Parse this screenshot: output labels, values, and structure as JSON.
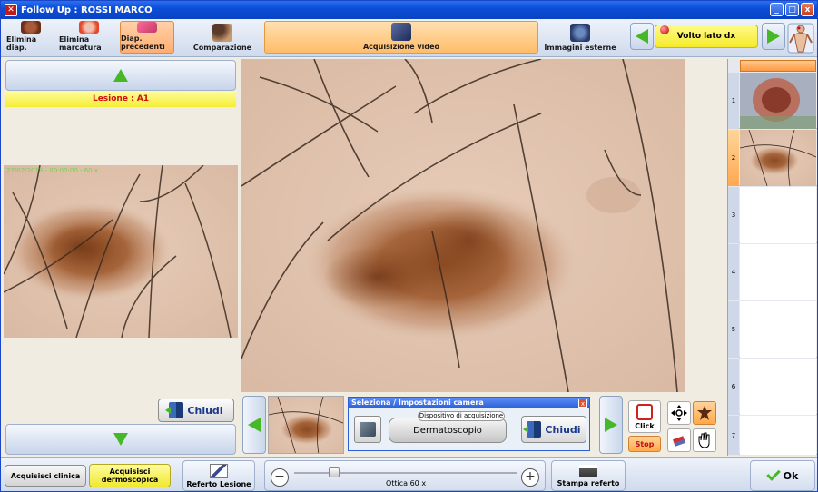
{
  "window": {
    "title": "Follow Up : ROSSI MARCO",
    "controls": {
      "minimize": "_",
      "maximize": "□",
      "close": "x"
    }
  },
  "toolbar": {
    "elimina_diap": "Elimina diap.",
    "elimina_marcatura": "Elimina marcatura",
    "diap_precedenti": "Diap. precedenti",
    "comparazione": "Comparazione",
    "acquisizione_video": "Acquisizione video",
    "immagini_esterne": "Immagini esterne",
    "site": "Volto lato dx"
  },
  "left_panel": {
    "lesion_label": "Lesione : A1",
    "image_caption": "27/02/2013 - 00:00:00 - 60 x",
    "close_label": "Chiudi"
  },
  "camera_panel": {
    "title": "Seleziona / Impostazioni camera",
    "close_x": "x",
    "device_legend": "Dispositivo di acquisizione",
    "device_value": "Dermatoscopio",
    "close_label": "Chiudi"
  },
  "capture": {
    "click_label": "Click",
    "stop_label": "Stop"
  },
  "thumbnails": {
    "slots": [
      "1",
      "2",
      "3",
      "4",
      "5",
      "6",
      "7"
    ],
    "selected": "2"
  },
  "bottombar": {
    "acquisisci_clinica": "Acquisisci clinica",
    "acquisisci_dermoscopica": "Acquisisci dermoscopica",
    "referto_lesione": "Referto Lesione",
    "zoom_minus": "−",
    "zoom_plus": "+",
    "zoom_label": "Ottica 60 x",
    "stampa_referto": "Stampa referto",
    "ok": "Ok"
  },
  "colors": {
    "accent_orange": "#ffae72",
    "highlight_yellow": "#f5ee33",
    "lesion_red": "#d01010",
    "title_blue": "#0b4ed8",
    "arrow_green": "#46b828"
  }
}
